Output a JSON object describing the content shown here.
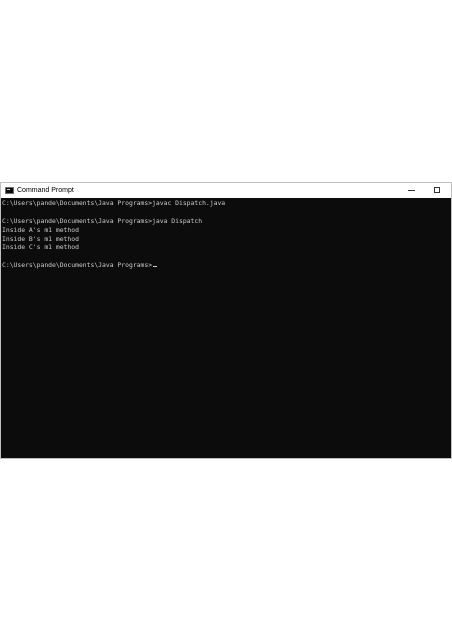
{
  "window": {
    "title": "Command Prompt",
    "icon": "cmd-icon",
    "controls": [
      "minimize-icon",
      "maximize-icon"
    ]
  },
  "console": {
    "lines": [
      "C:\\Users\\pande\\Documents\\Java Programs>javac Dispatch.java",
      "",
      "C:\\Users\\pande\\Documents\\Java Programs>java Dispatch",
      "Inside A's m1 method",
      "Inside B's m1 method",
      "Inside C's m1 method",
      "",
      "C:\\Users\\pande\\Documents\\Java Programs>"
    ]
  },
  "colors": {
    "console_background": "#0c0c0c",
    "console_text": "#cccccc",
    "titlebar_background": "#ffffff"
  }
}
